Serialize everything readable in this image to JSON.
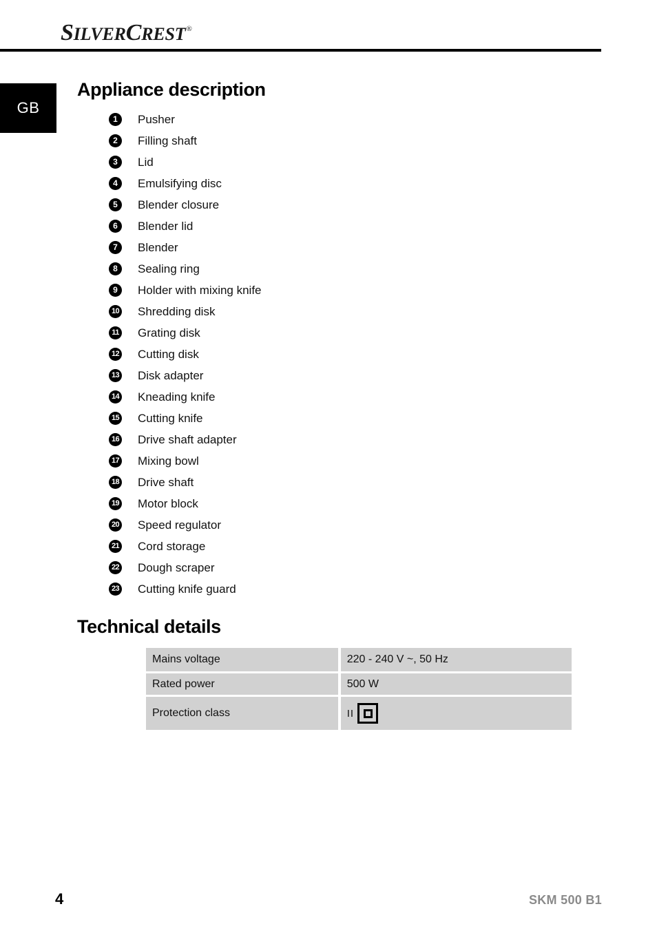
{
  "brand": {
    "name_part_1": "S",
    "name_part_2": "ILVER",
    "name_part_3": "C",
    "name_part_4": "REST",
    "registered_mark": "®",
    "full_name": "SILVERCREST"
  },
  "language_tab": {
    "label": "GB"
  },
  "sections": {
    "appliance_description": {
      "heading": "Appliance description",
      "items": [
        {
          "number": "1",
          "label": "Pusher"
        },
        {
          "number": "2",
          "label": "Filling shaft"
        },
        {
          "number": "3",
          "label": "Lid"
        },
        {
          "number": "4",
          "label": "Emulsifying disc"
        },
        {
          "number": "5",
          "label": "Blender closure"
        },
        {
          "number": "6",
          "label": "Blender lid"
        },
        {
          "number": "7",
          "label": "Blender"
        },
        {
          "number": "8",
          "label": "Sealing ring"
        },
        {
          "number": "9",
          "label": "Holder with mixing knife"
        },
        {
          "number": "10",
          "label": "Shredding disk"
        },
        {
          "number": "11",
          "label": "Grating disk"
        },
        {
          "number": "12",
          "label": "Cutting disk"
        },
        {
          "number": "13",
          "label": "Disk adapter"
        },
        {
          "number": "14",
          "label": "Kneading knife"
        },
        {
          "number": "15",
          "label": "Cutting knife"
        },
        {
          "number": "16",
          "label": "Drive shaft adapter"
        },
        {
          "number": "17",
          "label": "Mixing bowl"
        },
        {
          "number": "18",
          "label": "Drive shaft"
        },
        {
          "number": "19",
          "label": "Motor block"
        },
        {
          "number": "20",
          "label": "Speed regulator"
        },
        {
          "number": "21",
          "label": "Cord storage"
        },
        {
          "number": "22",
          "label": "Dough scraper"
        },
        {
          "number": "23",
          "label": "Cutting knife guard"
        }
      ]
    },
    "technical_details": {
      "heading": "Technical details",
      "rows": [
        {
          "label": "Mains voltage",
          "value": "220 - 240 V ~, 50 Hz"
        },
        {
          "label": "Rated power",
          "value": "500 W"
        },
        {
          "label": "Protection class",
          "value": "II",
          "symbol": "class-ii-double-square"
        }
      ]
    }
  },
  "footer": {
    "page_number": "4",
    "model": "SKM 500 B1"
  },
  "colors": {
    "text": "#000000",
    "table_cell_background": "#d1d1d1",
    "footer_model_text": "#8a8a8a",
    "tab_background": "#000000",
    "page_background": "#ffffff"
  }
}
